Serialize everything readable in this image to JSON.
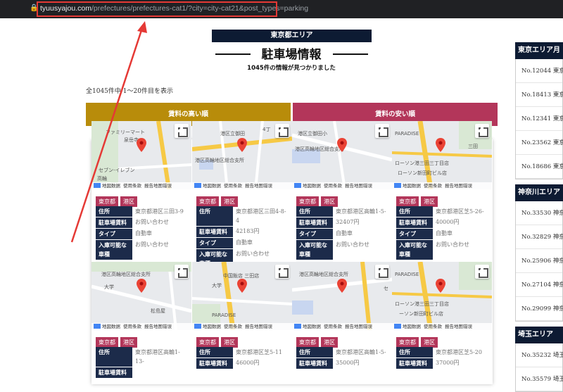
{
  "browser": {
    "url_host": "tyuusyajou.com",
    "url_path": "/prefectures/prefectures-cat1/?city=city-cat21&post_types=parking"
  },
  "header": {
    "area_badge": "東京都エリア",
    "title": "駐車場情報",
    "subtitle": "1045件の情報が見つかりました"
  },
  "results": {
    "count_text": "全1045件中 1〜20件目を表示"
  },
  "sort": {
    "high_label": "賃料の高い順",
    "low_label": "賃料の安い順"
  },
  "map_footer": {
    "google": "Google",
    "map_data": "地図数据",
    "terms": "使用条款",
    "report": "报告地图错误"
  },
  "map_labels": {
    "c1": [
      "ファミリーマート",
      "泉岳寺",
      "セブン-イレブン",
      "高輪"
    ],
    "c2": [
      "港区立御田",
      "港区高輪地区総合支所",
      "4丁"
    ],
    "c3": [
      "港区立御田小",
      "港区高輪地区総合支所",
      "白"
    ],
    "c4": [
      "PARADISE",
      "ローソン港三田三丁目店",
      "ローソン新田町ビル店",
      "三田"
    ],
    "c5": [
      "港区高輪地区総合支所",
      "大学",
      "松島屋"
    ],
    "c6": [
      "中国飯店 三田店",
      "大学",
      "PARADISE"
    ],
    "c7": [
      "港区高輪地区総合支所",
      "セ"
    ],
    "c8": [
      "PARADISE",
      "ローソン港三田三丁目店",
      "ーソン新田町ビル店"
    ]
  },
  "cards": [
    {
      "pref": "東京都",
      "ward": "港区",
      "address": "東京都港区三田3-9",
      "fee": "お問い合わせ",
      "type": "自動車",
      "vehicle": "お問い合わせ"
    },
    {
      "pref": "東京都",
      "ward": "港区",
      "address": "東京都港区三田4-8-4",
      "fee": "42183円",
      "type": "自動車",
      "vehicle": "お問い合わせ"
    },
    {
      "pref": "東京都",
      "ward": "港区",
      "address": "東京都港区高輪1-5-",
      "fee": "32407円",
      "type": "自動車",
      "vehicle": "お問い合わせ"
    },
    {
      "pref": "東京都",
      "ward": "港区",
      "address": "東京都港区芝5-26-",
      "fee": "40000円",
      "type": "自動車",
      "vehicle": "お問い合わせ"
    },
    {
      "pref": "東京都",
      "ward": "港区",
      "address": "東京都港区高輪1-13-",
      "fee": "",
      "type": "",
      "vehicle": ""
    },
    {
      "pref": "東京都",
      "ward": "港区",
      "address": "東京都港区芝5-11",
      "fee": "46000円",
      "type": "",
      "vehicle": ""
    },
    {
      "pref": "東京都",
      "ward": "港区",
      "address": "東京都港区高輪1-5-",
      "fee": "35000円",
      "type": "",
      "vehicle": ""
    },
    {
      "pref": "東京都",
      "ward": "港区",
      "address": "東京都港区芝5-20",
      "fee": "37000円",
      "type": "",
      "vehicle": ""
    }
  ],
  "labels": {
    "address": "住所",
    "fee": "駐車場賃料",
    "type": "タイプ",
    "vehicle": "入庫可能な車種"
  },
  "sidebar": [
    {
      "heading": "東京エリア月",
      "items": [
        "No.12044 東京",
        "No.18413 東京",
        "No.12341 東京",
        "No.23562 東京",
        "No.18686 東京"
      ]
    },
    {
      "heading": "神奈川エリア",
      "items": [
        "No.33530 神奈",
        "No.32829 神奈",
        "No.25906 神奈",
        "No.27104 神奈",
        "No.29099 神奈"
      ]
    },
    {
      "heading": "埼玉エリア",
      "items": [
        "No.35232 埼玉",
        "No.35579 埼玉"
      ]
    }
  ],
  "colors": {
    "navy": "#0d1b33",
    "gold": "#b88c0a",
    "crimson": "#b3365a",
    "annotation_red": "#e53935"
  }
}
